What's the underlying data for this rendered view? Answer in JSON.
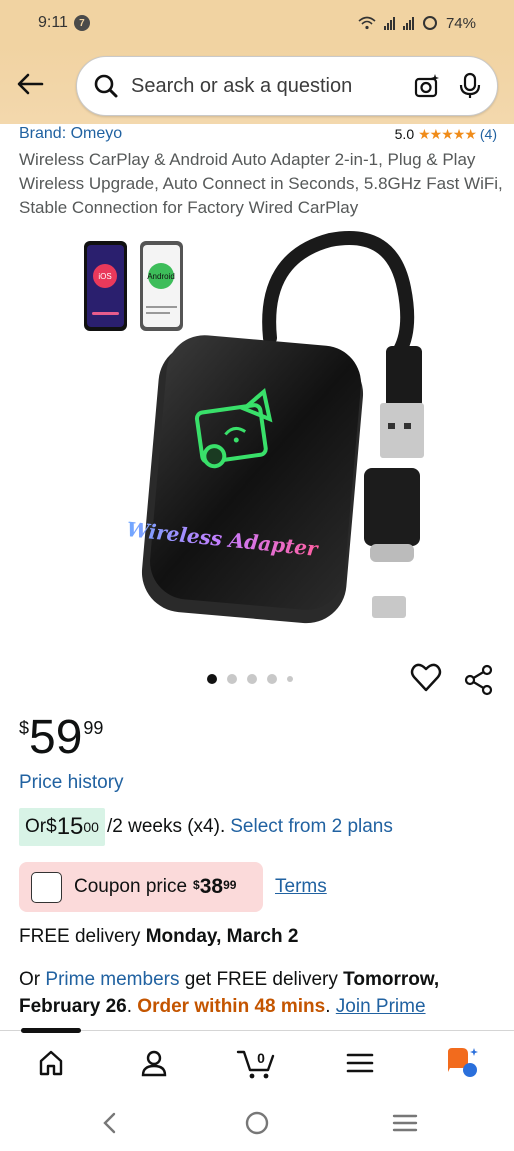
{
  "status_bar": {
    "time": "9:11",
    "notification_count": "7",
    "battery": "74%"
  },
  "search": {
    "placeholder": "Search or ask a question"
  },
  "product": {
    "brand": "Brand: Omeyo",
    "rating": "5.0",
    "stars": "★★★★★",
    "rating_count": "(4)",
    "title": "Wireless CarPlay & Android Auto Adapter 2-in-1, Plug & Play Wireless Upgrade, Auto Connect in Seconds, 5.8GHz Fast WiFi, Stable Connection for Factory Wired CarPlay",
    "image_text": {
      "adapter_label": "Wireless Adapter",
      "phone_ios": "iOS",
      "phone_android": "Android"
    }
  },
  "gallery": {
    "dots_total": 5,
    "active_dot": 0
  },
  "price": {
    "symbol": "$",
    "whole": "59",
    "fraction": "99",
    "history_link": "Price history"
  },
  "installments": {
    "prefix": "Or ",
    "symbol": "$",
    "whole": "15",
    "fraction": "00",
    "period": "/2 weeks (x4).",
    "link": "Select from 2 plans"
  },
  "coupon": {
    "label": "Coupon price",
    "symbol": "$",
    "whole": "38",
    "fraction": "99",
    "terms": "Terms"
  },
  "delivery": {
    "prefix": "FREE delivery ",
    "date": "Monday, March 2"
  },
  "prime_delivery": {
    "prefix": "Or ",
    "prime_link": "Prime members",
    "middle": " get FREE delivery ",
    "date": "Tomorrow, February 26",
    "dot": ". ",
    "order_within": "Order within 48 mins",
    "dot2": ". ",
    "join": "Join Prime"
  },
  "bottom_nav": {
    "items": [
      "home-icon",
      "account-icon",
      "cart-icon",
      "menu-icon",
      "rufus-icon"
    ],
    "cart_count": "0"
  },
  "colors": {
    "header_bg": "#f1d3a2",
    "link": "#2162a1",
    "star": "#f08c1a",
    "installment_bg": "#d8f3e6",
    "coupon_bg": "#fbdada",
    "urgent": "#c45500"
  }
}
